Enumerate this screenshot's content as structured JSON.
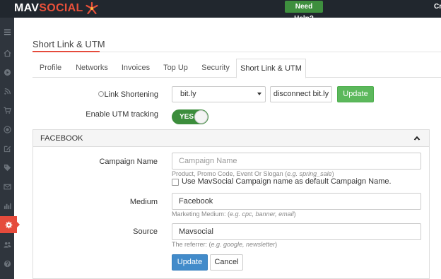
{
  "header": {
    "logo_mav": "MAV",
    "logo_social": "SOCIAL",
    "help_button": "Need Help?",
    "cut_text": "Cr"
  },
  "sidebar": {
    "items": [
      {
        "icon": "hamburger-icon"
      },
      {
        "icon": "home-icon"
      },
      {
        "icon": "play-circle-icon"
      },
      {
        "icon": "rss-icon"
      },
      {
        "icon": "cart-icon"
      },
      {
        "icon": "record-icon"
      },
      {
        "icon": "edit-icon"
      },
      {
        "icon": "tag-icon"
      },
      {
        "icon": "mail-icon"
      },
      {
        "icon": "bar-chart-icon"
      },
      {
        "icon": "gear-icon",
        "active": true
      },
      {
        "icon": "users-icon"
      },
      {
        "icon": "help-icon"
      }
    ],
    "active_color": "#e54b3c"
  },
  "page": {
    "title": "Short Link & UTM"
  },
  "tabs": [
    {
      "label": "Profile"
    },
    {
      "label": "Networks"
    },
    {
      "label": "Invoices"
    },
    {
      "label": "Top Up"
    },
    {
      "label": "Security"
    },
    {
      "label": "Short Link & UTM",
      "active": true
    }
  ],
  "link_shortening": {
    "label": "Link Shortening",
    "selected": "bit.ly",
    "disconnect_button": "disconnect bit.ly",
    "update_button": "Update"
  },
  "utm": {
    "label": "Enable UTM tracking",
    "toggle": "YES"
  },
  "facebook": {
    "panel_title": "FACEBOOK",
    "campaign": {
      "label": "Campaign Name",
      "placeholder": "Campaign Name",
      "help_prefix": "Product, Promo Code, Event Or Slogan (",
      "help_example": "e.g. spring_sale",
      "help_suffix": ")",
      "checkbox_label": "Use MavSocial Campaign name as default Campaign Name."
    },
    "medium": {
      "label": "Medium",
      "value": "Facebook",
      "help_prefix": "Marketing Medium: (",
      "help_example": "e.g. cpc, banner, email",
      "help_suffix": ")"
    },
    "source": {
      "label": "Source",
      "value": "Mavsocial",
      "help_prefix": "The referrer: (",
      "help_example": "e.g. google, newsletter",
      "help_suffix": ")"
    },
    "update_button": "Update",
    "cancel_button": "Cancel"
  },
  "colors": {
    "topbar": "#21272e",
    "sidebar": "#2f353d",
    "accent_red": "#e54b3c",
    "green": "#5cb85c",
    "blue": "#428bca"
  }
}
